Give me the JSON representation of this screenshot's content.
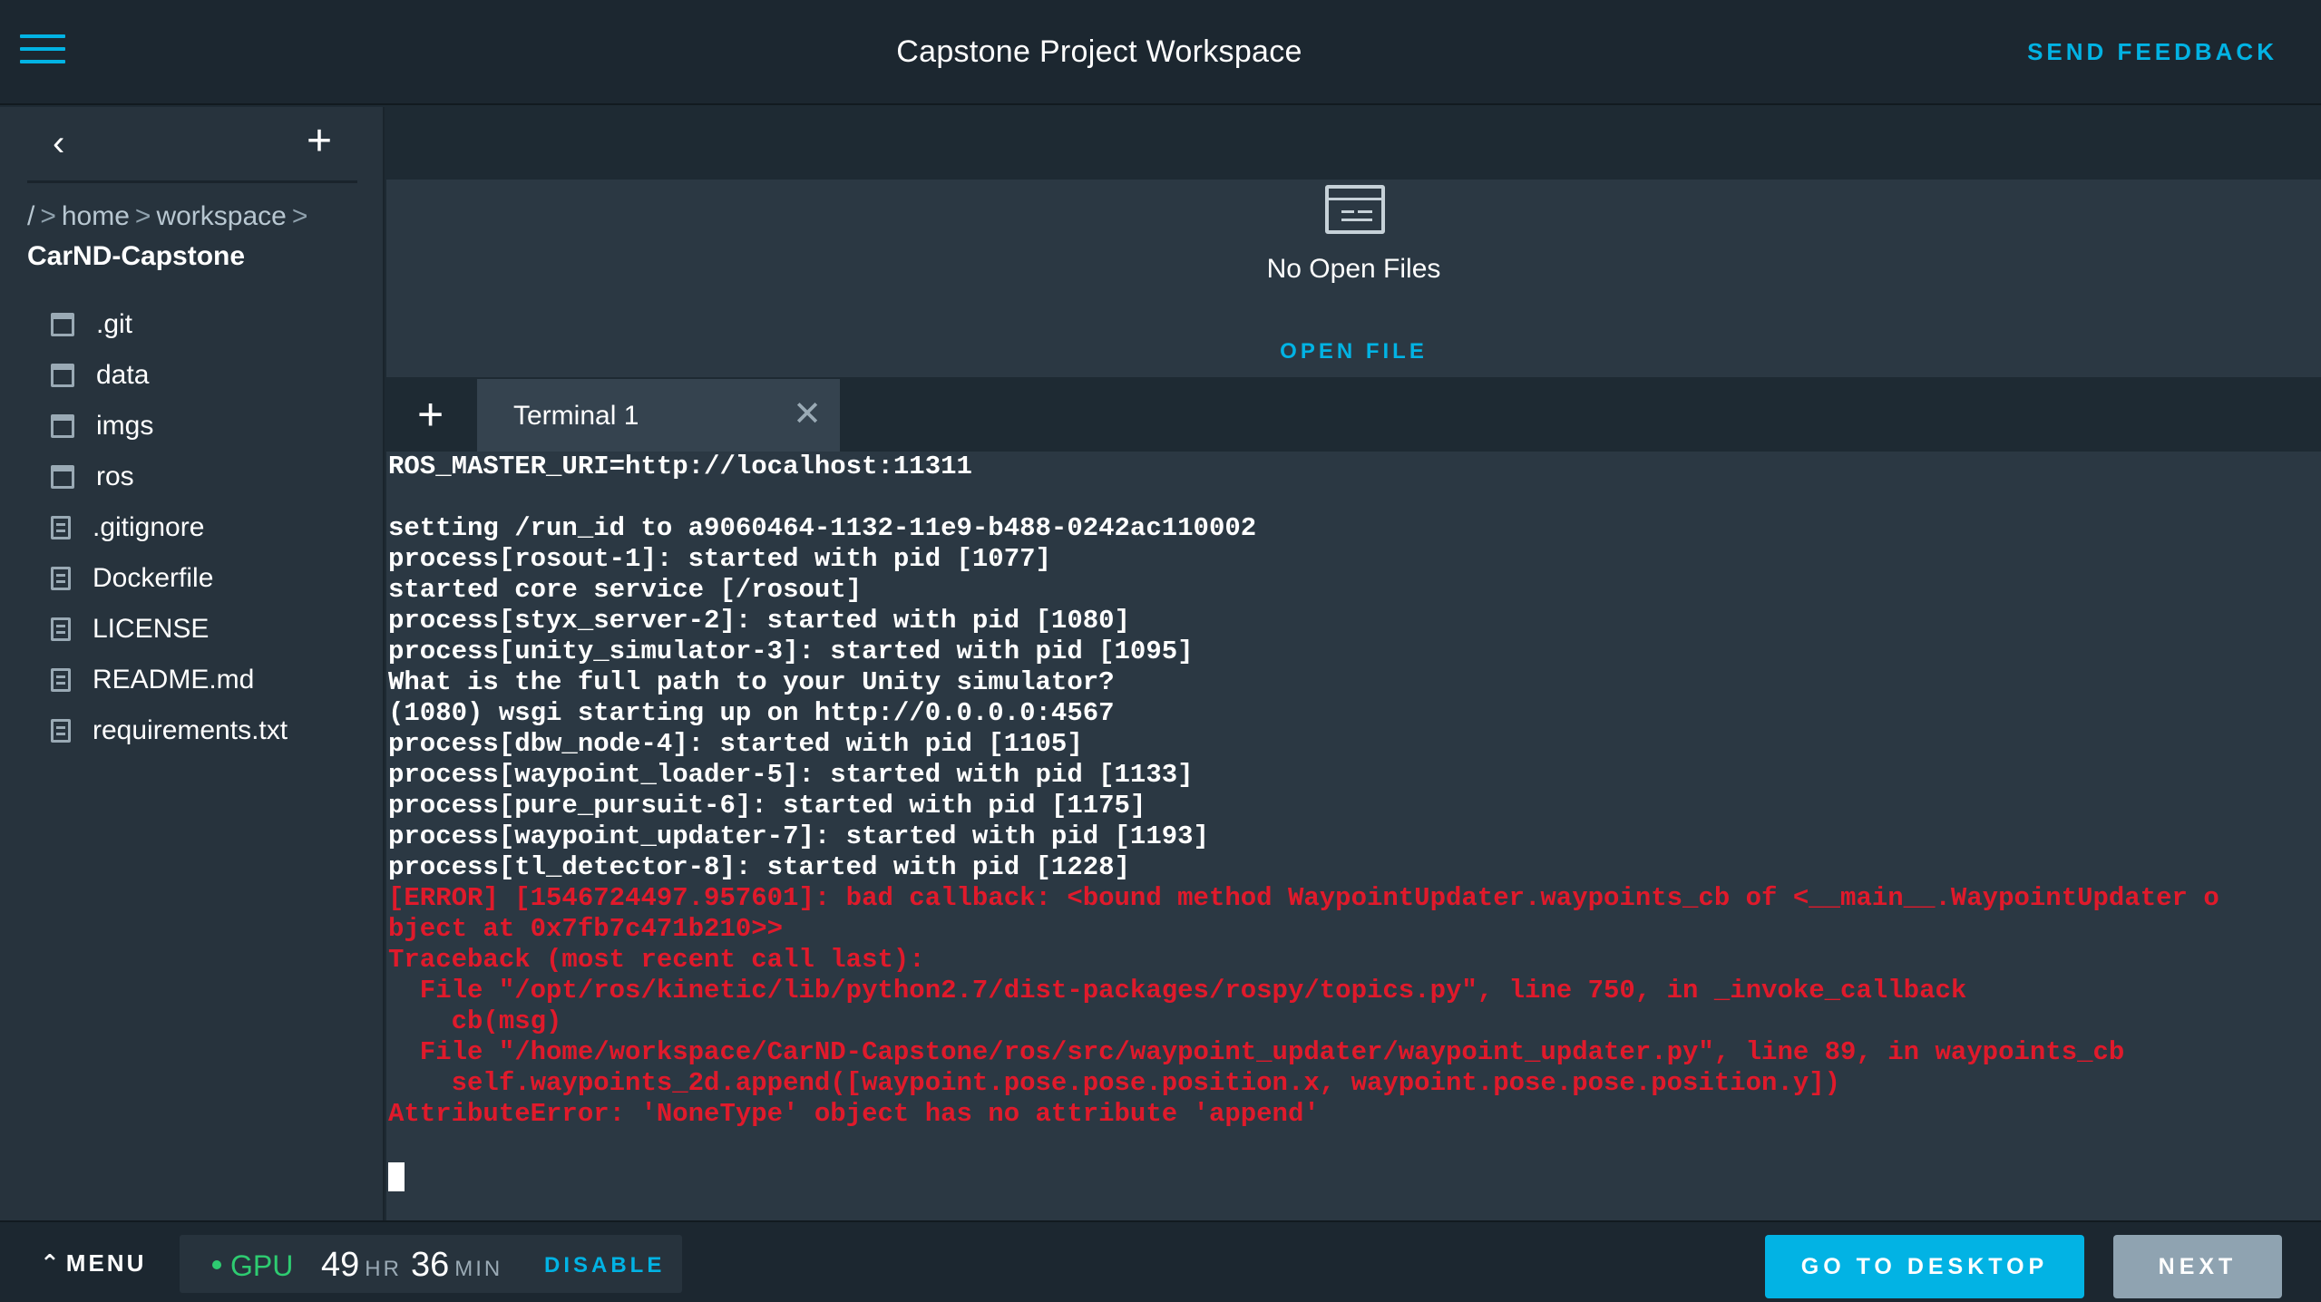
{
  "header": {
    "title": "Capstone Project Workspace",
    "feedback_label": "SEND FEEDBACK"
  },
  "sidebar": {
    "back_icon": "chevron-left-icon",
    "add_icon": "plus-icon",
    "breadcrumb": {
      "root": "/",
      "sep": ">",
      "home": "home",
      "workspace": "workspace"
    },
    "current_dir": "CarND-Capstone",
    "files": [
      {
        "name": ".git",
        "type": "folder"
      },
      {
        "name": "data",
        "type": "folder"
      },
      {
        "name": "imgs",
        "type": "folder"
      },
      {
        "name": "ros",
        "type": "folder"
      },
      {
        "name": ".gitignore",
        "type": "file"
      },
      {
        "name": "Dockerfile",
        "type": "file"
      },
      {
        "name": "LICENSE",
        "type": "file"
      },
      {
        "name": "README.md",
        "type": "file"
      },
      {
        "name": "requirements.txt",
        "type": "file"
      }
    ]
  },
  "editor": {
    "no_files_text": "No Open Files",
    "open_file_label": "OPEN FILE"
  },
  "terminal": {
    "add_tab": "+",
    "tab_label": "Terminal 1",
    "close": "✕",
    "lines": [
      {
        "text": "ROS_MASTER_URI=http://localhost:11311",
        "color": "white"
      },
      {
        "text": "",
        "color": "white"
      },
      {
        "text": "setting /run_id to a9060464-1132-11e9-b488-0242ac110002",
        "color": "white"
      },
      {
        "text": "process[rosout-1]: started with pid [1077]",
        "color": "white"
      },
      {
        "text": "started core service [/rosout]",
        "color": "white"
      },
      {
        "text": "process[styx_server-2]: started with pid [1080]",
        "color": "white"
      },
      {
        "text": "process[unity_simulator-3]: started with pid [1095]",
        "color": "white"
      },
      {
        "text": "What is the full path to your Unity simulator?",
        "color": "white"
      },
      {
        "text": "(1080) wsgi starting up on http://0.0.0.0:4567",
        "color": "white"
      },
      {
        "text": "process[dbw_node-4]: started with pid [1105]",
        "color": "white"
      },
      {
        "text": "process[waypoint_loader-5]: started with pid [1133]",
        "color": "white"
      },
      {
        "text": "process[pure_pursuit-6]: started with pid [1175]",
        "color": "white"
      },
      {
        "text": "process[waypoint_updater-7]: started with pid [1193]",
        "color": "white"
      },
      {
        "text": "process[tl_detector-8]: started with pid [1228]",
        "color": "white"
      },
      {
        "text": "[ERROR] [1546724497.957601]: bad callback: <bound method WaypointUpdater.waypoints_cb of <__main__.WaypointUpdater o",
        "color": "red"
      },
      {
        "text": "bject at 0x7fb7c471b210>>",
        "color": "red"
      },
      {
        "text": "Traceback (most recent call last):",
        "color": "red"
      },
      {
        "text": "  File \"/opt/ros/kinetic/lib/python2.7/dist-packages/rospy/topics.py\", line 750, in _invoke_callback",
        "color": "red"
      },
      {
        "text": "    cb(msg)",
        "color": "red"
      },
      {
        "text": "  File \"/home/workspace/CarND-Capstone/ros/src/waypoint_updater/waypoint_updater.py\", line 89, in waypoints_cb",
        "color": "red"
      },
      {
        "text": "    self.waypoints_2d.append([waypoint.pose.pose.position.x, waypoint.pose.pose.position.y])",
        "color": "red"
      },
      {
        "text": "AttributeError: 'NoneType' object has no attribute 'append'",
        "color": "red"
      }
    ]
  },
  "footer": {
    "menu_label": "MENU",
    "gpu_label": "GPU",
    "hours": "49",
    "hr_unit": "HR",
    "minutes": "36",
    "min_unit": "MIN",
    "disable_label": "DISABLE",
    "desktop_label": "GO TO DESKTOP",
    "next_label": "NEXT"
  },
  "colors": {
    "accent": "#02b3e4",
    "error": "#e01a2b",
    "gpu_status": "#2ecc71"
  }
}
